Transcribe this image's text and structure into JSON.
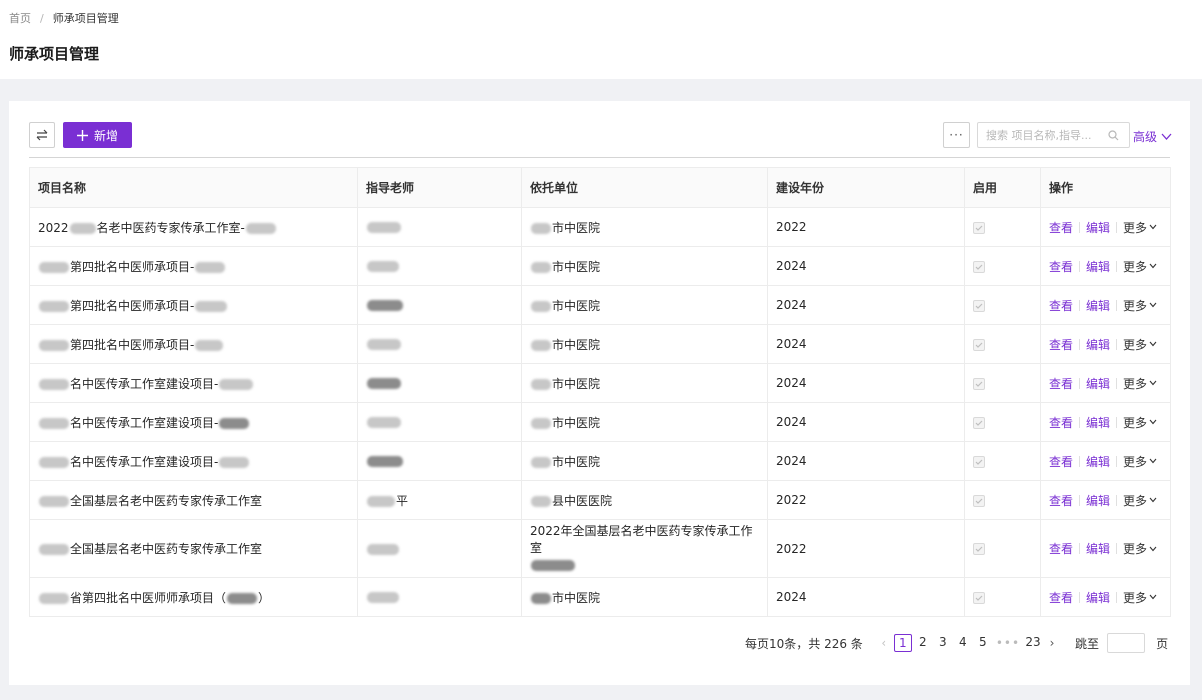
{
  "breadcrumb": {
    "home": "首页",
    "current": "师承项目管理"
  },
  "page_title": "师承项目管理",
  "toolbar": {
    "add_label": "新增",
    "more_label": "···",
    "search_placeholder": "搜索 项目名称,指导...",
    "advanced_label": "高级"
  },
  "table": {
    "columns": [
      "项目名称",
      "指导老师",
      "依托单位",
      "建设年份",
      "启用",
      "操作"
    ],
    "rows": [
      {
        "name_pre": "2022",
        "name": "名老中医药专家传承工作室-",
        "unit": "市中医院",
        "year": "2022"
      },
      {
        "name_pre": "",
        "name": "第四批名中医师承项目-",
        "unit": "市中医院",
        "year": "2024"
      },
      {
        "name_pre": "",
        "name": "第四批名中医师承项目-",
        "unit": "市中医院",
        "year": "2024"
      },
      {
        "name_pre": "",
        "name": "第四批名中医师承项目-",
        "unit": "市中医院",
        "year": "2024"
      },
      {
        "name_pre": "",
        "name": "名中医传承工作室建设项目-",
        "unit": "市中医院",
        "year": "2024"
      },
      {
        "name_pre": "",
        "name": "名中医传承工作室建设项目-",
        "unit": "市中医院",
        "year": "2024"
      },
      {
        "name_pre": "",
        "name": "名中医传承工作室建设项目-",
        "unit": "市中医院",
        "year": "2024"
      },
      {
        "name_pre": "",
        "name": "全国基层名老中医药专家传承工作室",
        "unit": "县中医医院",
        "year": "2022",
        "teacher_tail": "平"
      },
      {
        "name_pre": "",
        "name": "全国基层名老中医药专家传承工作室",
        "unit": "2022年全国基层名老中医药专家传承工作室",
        "year": "2022"
      },
      {
        "name_pre": "",
        "name": "省第四批名中医师师承项目（",
        "name_tail": "）",
        "unit": "市中医院",
        "year": "2024"
      }
    ],
    "actions": {
      "view": "查看",
      "edit": "编辑",
      "more": "更多"
    }
  },
  "pagination": {
    "summary": "每页10条，共 226 条",
    "pages": [
      "1",
      "2",
      "3",
      "4",
      "5"
    ],
    "ellipsis": "•••",
    "last": "23",
    "current": "1",
    "jump_label": "跳至",
    "page_unit": "页"
  }
}
